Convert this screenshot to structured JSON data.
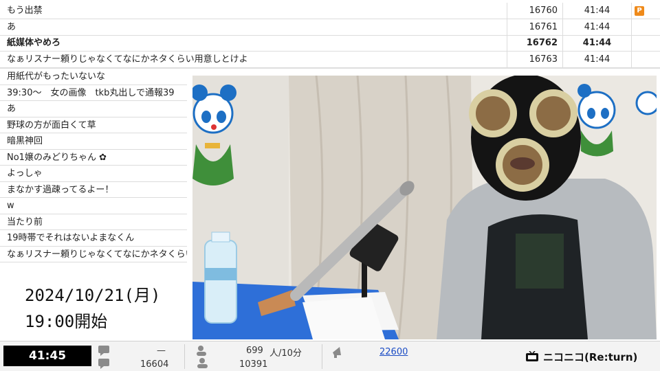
{
  "comments_top": [
    {
      "text": "もう出禁",
      "number": "16760",
      "time": "41:44",
      "badge": "P",
      "bold": false
    },
    {
      "text": "あ",
      "number": "16761",
      "time": "41:44",
      "badge": "",
      "bold": false
    },
    {
      "text": "紙媒体やめろ",
      "number": "16762",
      "time": "41:44",
      "badge": "",
      "bold": true
    },
    {
      "text": "なぁリスナー頼りじゃなくてなにかネタくらい用意しとけよ",
      "number": "16763",
      "time": "41:44",
      "badge": "",
      "bold": false
    }
  ],
  "comments_left": [
    "用紙代がもったいないな",
    "39:30～　女の画像　tkb丸出しで通報39",
    "あ",
    "野球の方が面白くて草",
    "暗黒神回",
    "No1嬢のみどりちゃん ✿",
    "よっしゃ",
    "まなかす過疎ってるよー！",
    "w",
    "当たり前",
    "19時帯でそれはないよまなくん",
    "なぁリスナー頼りじゃなくてなにかネタくらい用意"
  ],
  "overlay_date": {
    "line1": "2024/10/21(月)",
    "line2": "19:00開始"
  },
  "bottom_bar": {
    "elapsed": "41:45",
    "comment_dash": "—",
    "comment_count": "16604",
    "active_viewers": "699",
    "active_unit": "人/10分",
    "total_viewers": "10391",
    "ad_points": "22600",
    "brand": "ニコニコ(Re:turn)"
  },
  "colors": {
    "timer_bg": "#000000",
    "badge": "#ef8a1a",
    "link": "#1a4bc4"
  }
}
